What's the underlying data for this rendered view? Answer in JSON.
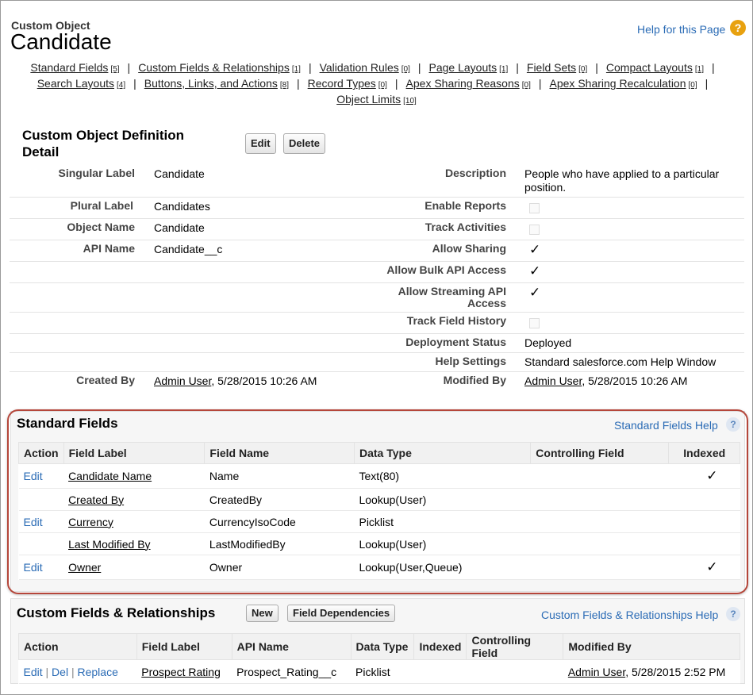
{
  "header": {
    "object_type": "Custom Object",
    "object_name": "Candidate",
    "help_link": "Help for this Page",
    "help_icon": "?"
  },
  "nav_links": [
    {
      "label": "Standard Fields",
      "count": "[5]"
    },
    {
      "label": "Custom Fields & Relationships",
      "count": "[1]"
    },
    {
      "label": "Validation Rules",
      "count": "[0]"
    },
    {
      "label": "Page Layouts",
      "count": "[1]"
    },
    {
      "label": "Field Sets",
      "count": "[0]"
    },
    {
      "label": "Compact Layouts",
      "count": "[1]"
    },
    {
      "label": "Search Layouts",
      "count": "[4]"
    },
    {
      "label": "Buttons, Links, and Actions",
      "count": "[8]"
    },
    {
      "label": "Record Types",
      "count": "[0]"
    },
    {
      "label": "Apex Sharing Reasons",
      "count": "[0]"
    },
    {
      "label": "Apex Sharing Recalculation",
      "count": "[0]"
    },
    {
      "label": "Object Limits",
      "count": "[10]"
    }
  ],
  "separator": "|",
  "detail": {
    "title": "Custom Object Definition Detail",
    "edit_button": "Edit",
    "delete_button": "Delete",
    "left": [
      {
        "label": "Singular Label",
        "value": "Candidate"
      },
      {
        "label": "Plural Label",
        "value": "Candidates"
      },
      {
        "label": "Object Name",
        "value": "Candidate"
      },
      {
        "label": "API Name",
        "value": "Candidate__c"
      }
    ],
    "right": [
      {
        "label": "Description",
        "value": "People who have applied to a particular position."
      },
      {
        "label": "Enable Reports",
        "checked": false
      },
      {
        "label": "Track Activities",
        "checked": false
      },
      {
        "label": "Allow Sharing",
        "checked": true
      },
      {
        "label": "Allow Bulk API Access",
        "checked": true
      },
      {
        "label": "Allow Streaming API Access",
        "checked": true
      },
      {
        "label": "Track Field History",
        "checked": false
      },
      {
        "label": "Deployment Status",
        "value": "Deployed"
      },
      {
        "label": "Help Settings",
        "value": "Standard salesforce.com Help Window"
      }
    ],
    "created_by": {
      "label": "Created By",
      "user": "Admin User",
      "date": ", 5/28/2015 10:26 AM"
    },
    "modified_by": {
      "label": "Modified By",
      "user": "Admin User",
      "date": ", 5/28/2015 10:26 AM"
    },
    "checkmark": "✓"
  },
  "standard_fields": {
    "title": "Standard Fields",
    "help_link": "Standard Fields Help",
    "columns": [
      "Action",
      "Field Label",
      "Field Name",
      "Data Type",
      "Controlling Field",
      "Indexed"
    ],
    "rows": [
      {
        "action": "Edit",
        "label": "Candidate Name",
        "name": "Name",
        "type": "Text(80)",
        "controlling": "",
        "indexed": true
      },
      {
        "action": "",
        "label": "Created By",
        "name": "CreatedBy",
        "type": "Lookup(User)",
        "controlling": "",
        "indexed": false
      },
      {
        "action": "Edit",
        "label": "Currency",
        "name": "CurrencyIsoCode",
        "type": "Picklist",
        "controlling": "",
        "indexed": false
      },
      {
        "action": "",
        "label": "Last Modified By",
        "name": "LastModifiedBy",
        "type": "Lookup(User)",
        "controlling": "",
        "indexed": false
      },
      {
        "action": "Edit",
        "label": "Owner",
        "name": "Owner",
        "type": "Lookup(User,Queue)",
        "controlling": "",
        "indexed": true
      }
    ]
  },
  "custom_fields": {
    "title": "Custom Fields & Relationships",
    "new_button": "New",
    "dependencies_button": "Field Dependencies",
    "help_link": "Custom Fields & Relationships Help",
    "columns": [
      "Action",
      "Field Label",
      "API Name",
      "Data Type",
      "Indexed",
      "Controlling Field",
      "Modified By"
    ],
    "rows": [
      {
        "edit": "Edit",
        "del": "Del",
        "replace": "Replace",
        "label": "Prospect Rating",
        "api": "Prospect_Rating__c",
        "type": "Picklist",
        "indexed": "",
        "controlling": "",
        "modified_user": "Admin User",
        "modified_date": ", 5/28/2015 2:52 PM"
      }
    ]
  }
}
